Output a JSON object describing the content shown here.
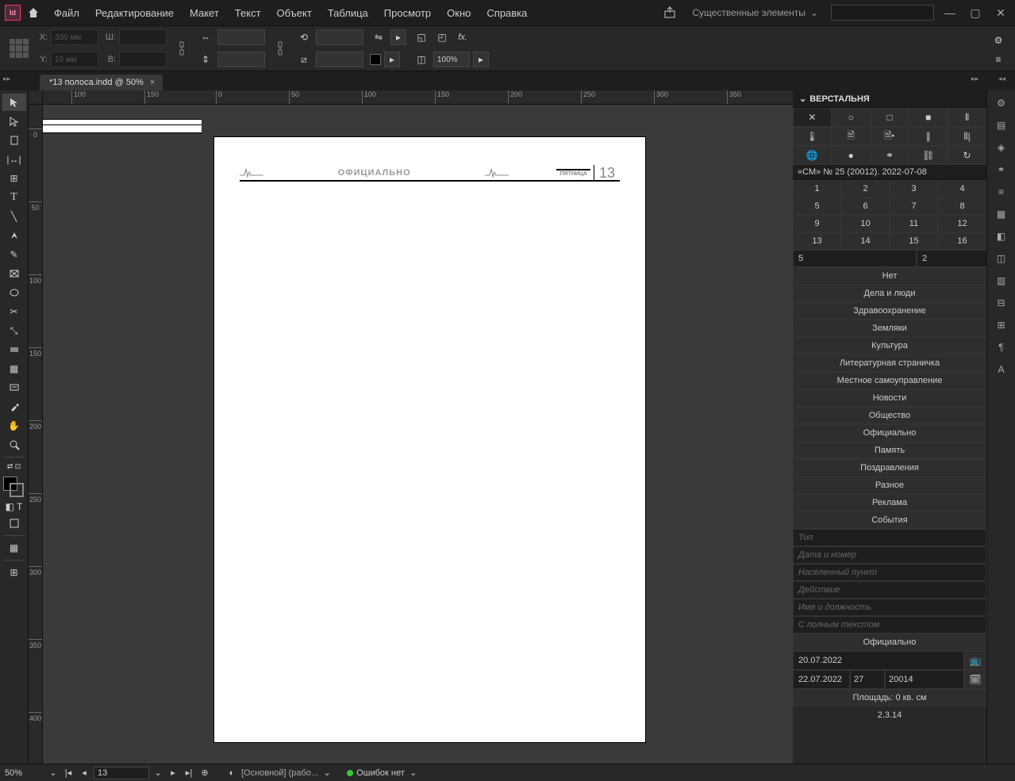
{
  "menu": {
    "items": [
      "Файл",
      "Редактирование",
      "Макет",
      "Текст",
      "Объект",
      "Таблица",
      "Просмотр",
      "Окно",
      "Справка"
    ],
    "workspace": "Существенные элементы"
  },
  "control": {
    "x_label": "X:",
    "y_label": "Y:",
    "w_label": "Ш:",
    "h_label": "В:",
    "x_val": "330 мм",
    "y_val": "10 мм",
    "zoom": "100%"
  },
  "doc": {
    "tab": "*13 полоса.indd @ 50%"
  },
  "ruler_h": [
    "100",
    "150",
    "200",
    "250",
    "300",
    "350"
  ],
  "ruler_h_pre": [
    "0"
  ],
  "ruler_h_pre2": [
    "50"
  ],
  "ruler_v": [
    "0",
    "50",
    "100",
    "150",
    "200",
    "250",
    "300",
    "350",
    "400"
  ],
  "page": {
    "title": "ОФИЦИАЛЬНО",
    "day": "ПЯТНИЦА",
    "num": "13"
  },
  "panel": {
    "title": "ВЕРСТАЛЬНЯ",
    "issue": "«СМ» № 25 (20012). 2022-07-08",
    "grid": [
      "1",
      "2",
      "3",
      "4",
      "5",
      "6",
      "7",
      "8",
      "9",
      "10",
      "11",
      "12",
      "13",
      "14",
      "15",
      "16"
    ],
    "cols": "5",
    "rows": "2",
    "categories": [
      "Нет",
      "Дела и люди",
      "Здравоохранение",
      "Земляки",
      "Культура",
      "Литературная страничка",
      "Местное самоуправление",
      "Новости",
      "Общество",
      "Официально",
      "Память",
      "Поздравления",
      "Разное",
      "Реклама",
      "События"
    ],
    "placeholders": [
      "Тип",
      "Дата и номер",
      "Населенный пункт",
      "Действие",
      "Имя и должность",
      "С полным текстом"
    ],
    "section": "Официально",
    "date1": "20.07.2022",
    "date2": "22.07.2022",
    "date2b": "27",
    "date2c": "20014",
    "area": "Площадь: 0 кв. см",
    "ver": "2.3.14"
  },
  "status": {
    "zoom": "50%",
    "page": "13",
    "master": "[Основной] (рабо...",
    "errors": "Ошибок нет"
  }
}
